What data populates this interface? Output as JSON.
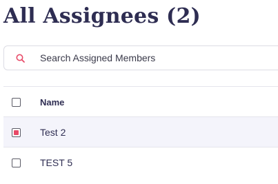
{
  "page": {
    "title": "All Assignees (2)"
  },
  "search": {
    "placeholder": "Search Assigned Members",
    "value": "",
    "icon": "search-icon"
  },
  "table": {
    "columns": [
      {
        "label": "Name"
      }
    ],
    "rows": [
      {
        "name": "Test 2",
        "checked": true
      },
      {
        "name": "TEST 5",
        "checked": false
      }
    ]
  },
  "colors": {
    "accent": "#e84a68",
    "text": "#2e2d52",
    "selected_row": "#f4f4fb"
  }
}
